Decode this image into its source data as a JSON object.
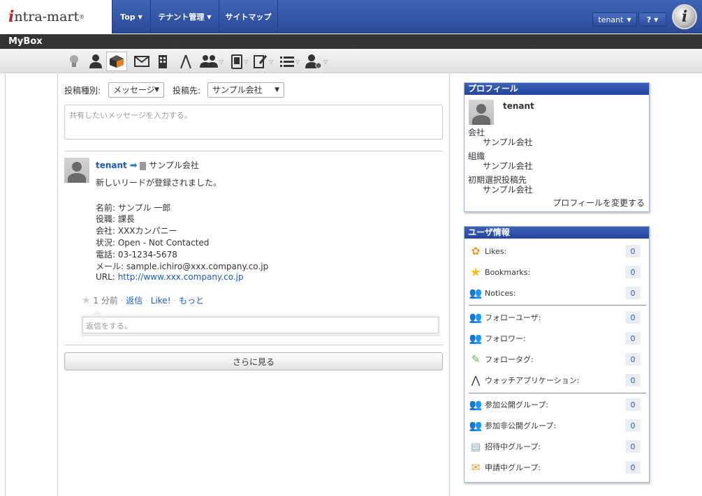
{
  "header": {
    "logo_text": "ntra-mart",
    "nav": [
      "Top",
      "テナント管理",
      "サイトマップ"
    ],
    "user_button": "tenant",
    "help_button": "?"
  },
  "mybox_title": "MyBox",
  "compose": {
    "post_type_label": "投稿種別:",
    "post_type_value": "メッセージ",
    "post_target_label": "投稿先:",
    "post_target_value": "サンプル会社",
    "placeholder": "共有したいメッセージを入力する。"
  },
  "post": {
    "author": "tenant",
    "target": "サンプル会社",
    "body": "新しいリードが登録されました。",
    "details": [
      "名前: サンプル 一郎",
      "役職: 課長",
      "会社: XXXカンパニー",
      "状況: Open - Not Contacted",
      "電話: 03-1234-5678",
      "メール: sample.ichiro@xxx.company.co.jp"
    ],
    "url_label": "URL:",
    "url": "http://www.xxx.company.co.jp",
    "time": "1 分前",
    "reply": "返信",
    "like": "Like!",
    "more": "もっと",
    "reply_placeholder": "返信をする。"
  },
  "more_button": "さらに見る",
  "profile": {
    "title": "プロフィール",
    "name": "tenant",
    "company_label": "会社",
    "company": "サンプル会社",
    "org_label": "組織",
    "org": "サンプル会社",
    "default_target_label": "初期選択投稿先",
    "default_target": "サンプル会社",
    "edit_link": "プロフィールを変更する"
  },
  "userinfo": {
    "title": "ユーザ情報",
    "rows": [
      {
        "label": "Likes:",
        "count": "0"
      },
      {
        "label": "Bookmarks:",
        "count": "0"
      },
      {
        "label": "Notices:",
        "count": "0"
      },
      {
        "label": "フォローユーザ:",
        "count": "0"
      },
      {
        "label": "フォロワー:",
        "count": "0"
      },
      {
        "label": "フォロータグ:",
        "count": "0"
      },
      {
        "label": "ウォッチアプリケーション:",
        "count": "0"
      },
      {
        "label": "参加公開グループ:",
        "count": "0"
      },
      {
        "label": "参加非公開グループ:",
        "count": "0"
      },
      {
        "label": "招待中グループ:",
        "count": "0"
      },
      {
        "label": "申請中グループ:",
        "count": "0"
      }
    ]
  }
}
